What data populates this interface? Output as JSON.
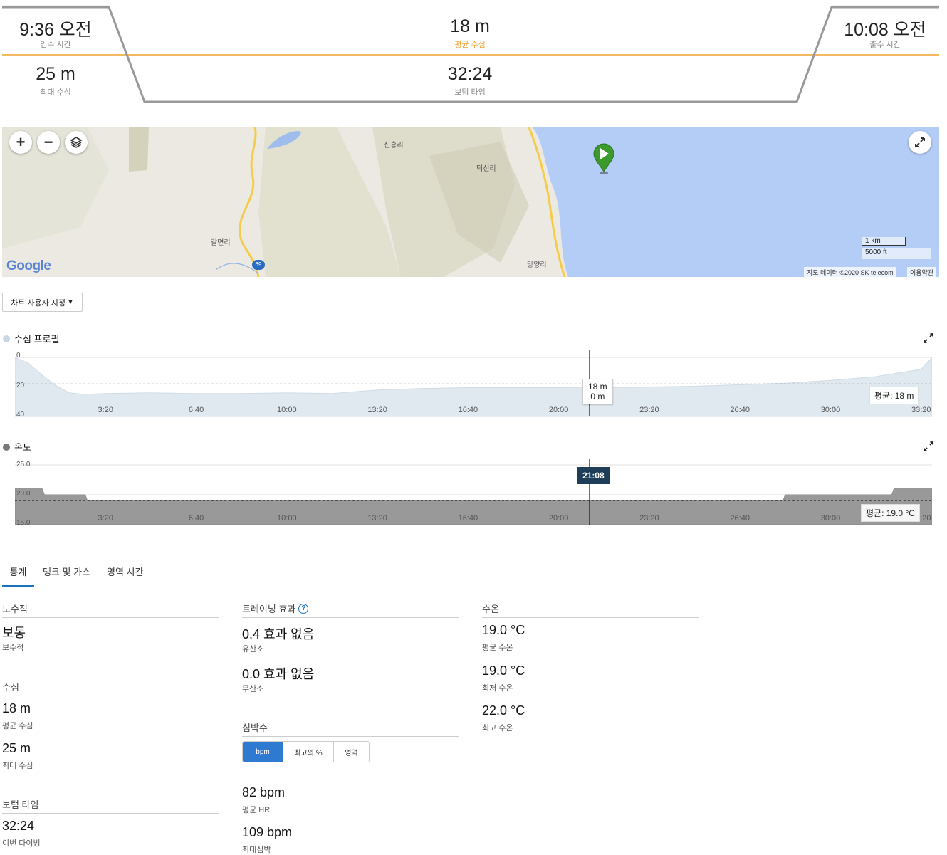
{
  "header": {
    "entry_time": {
      "value": "9:36 오전",
      "label": "입수 시간"
    },
    "avg_depth": {
      "value": "18 m",
      "label": "평균 수심"
    },
    "exit_time": {
      "value": "10:08 오전",
      "label": "출수 시간"
    },
    "max_depth": {
      "value": "25 m",
      "label": "최대 수심"
    },
    "bottom_time": {
      "value": "32:24",
      "label": "보텀 타임"
    },
    "colors": {
      "divider": "#f0a030",
      "profile": "#999999"
    }
  },
  "map": {
    "controls": {
      "zoom_in": "+",
      "zoom_out": "−"
    },
    "places": [
      "신흥리",
      "덕신리",
      "갈면리",
      "망양리"
    ],
    "road_number": "69",
    "scale": {
      "metric": "1 km",
      "imperial": "5000 ft"
    },
    "attribution": "지도 데이터 ©2020 SK telecom",
    "terms": "이용약관",
    "logo": "Google",
    "icons": [
      "zoom-in-icon",
      "zoom-out-icon",
      "layers-icon",
      "fullscreen-icon",
      "start-marker-icon"
    ]
  },
  "customize_button": "차트 사용자 지정",
  "charts": {
    "depth": {
      "title": "수심 프로필",
      "avg_label": "평균: 18 m",
      "tooltip": {
        "line1": "18 m",
        "line2": "0 m"
      },
      "dot_color": "#c9d6e3"
    },
    "temp": {
      "title": "온도",
      "avg_label": "평균: 19.0 °C",
      "time_tag": "21:08",
      "dot_color": "#777777"
    }
  },
  "chart_data": [
    {
      "type": "area",
      "title": "수심 프로필",
      "x_ticks": [
        "3:20",
        "6:40",
        "10:00",
        "13:20",
        "16:40",
        "20:00",
        "23:20",
        "26:40",
        "30:00",
        "33:20"
      ],
      "y_ticks": [
        "0",
        "20",
        "40"
      ],
      "ylim": [
        40,
        0
      ],
      "xlim_seconds": [
        0,
        2024
      ],
      "average": 18,
      "cursor_time_seconds": 1268,
      "x_seconds": [
        0,
        30,
        60,
        90,
        120,
        150,
        200,
        300,
        400,
        500,
        600,
        700,
        800,
        900,
        1000,
        1100,
        1200,
        1268,
        1300,
        1400,
        1500,
        1600,
        1700,
        1800,
        1900,
        1950,
        2000,
        2024
      ],
      "depth_m": [
        0,
        4,
        12,
        19,
        24,
        25,
        24.5,
        24,
        24.5,
        24.5,
        24,
        24.5,
        22,
        21,
        20.5,
        20.5,
        20.5,
        20,
        20.5,
        20,
        19.5,
        18.5,
        17.5,
        15.5,
        13,
        10.5,
        8,
        0
      ]
    },
    {
      "type": "area",
      "title": "온도",
      "x_ticks": [
        "3:20",
        "6:40",
        "10:00",
        "13:20",
        "16:40",
        "20:00",
        "23:20",
        "26:40",
        "30:00",
        "33:20"
      ],
      "y_ticks": [
        "25.0",
        "20.0",
        "15.0"
      ],
      "ylim": [
        15,
        25
      ],
      "xlim_seconds": [
        0,
        2024
      ],
      "average": 19.0,
      "cursor_label": "21:08",
      "x_seconds": [
        0,
        60,
        65,
        155,
        160,
        1695,
        1700,
        1935,
        1940,
        2024
      ],
      "temp_c": [
        21,
        21,
        20,
        20,
        19,
        19,
        20,
        20,
        21,
        21
      ]
    }
  ],
  "tabs": [
    "통계",
    "탱크 및 가스",
    "영역 시간"
  ],
  "stats": {
    "conservatism": {
      "title": "보수적",
      "value": "보통",
      "label": "보수적"
    },
    "depth": {
      "title": "수심",
      "avg_value": "18 m",
      "avg_label": "평균 수심",
      "max_value": "25 m",
      "max_label": "최대 수심"
    },
    "bottom_time": {
      "title": "보텀 타임",
      "value": "32:24",
      "label": "이번 다이빙"
    },
    "training": {
      "title": "트레이닝 효과",
      "aerobic_value": "0.4 효과 없음",
      "aerobic_label": "유산소",
      "anaerobic_value": "0.0 효과 없음",
      "anaerobic_label": "무산소"
    },
    "heart_rate": {
      "title": "심박수",
      "toggle": [
        "bpm",
        "최고의 %",
        "영역"
      ],
      "avg_value": "82 bpm",
      "avg_label": "평균 HR",
      "max_value": "109 bpm",
      "max_label": "최대심박"
    },
    "water_temp": {
      "title": "수온",
      "avg_value": "19.0 °C",
      "avg_label": "평균 수온",
      "min_value": "19.0 °C",
      "min_label": "최저 수온",
      "max_value": "22.0 °C",
      "max_label": "최고 수온"
    }
  }
}
